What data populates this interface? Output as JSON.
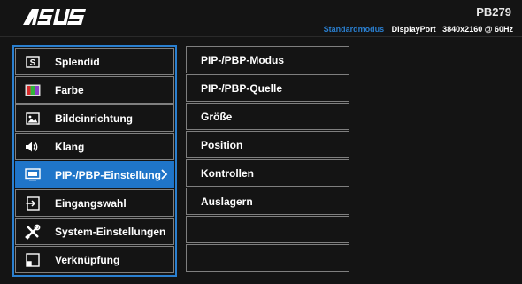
{
  "header": {
    "brand": "ASUS",
    "model": "PB279",
    "mode": "Standardmodus",
    "input": "DisplayPort",
    "resolution": "3840x2160 @ 60Hz"
  },
  "main_menu": {
    "items": [
      {
        "label": "Splendid",
        "icon": "splendid-icon"
      },
      {
        "label": "Farbe",
        "icon": "color-icon"
      },
      {
        "label": "Bildeinrichtung",
        "icon": "image-icon"
      },
      {
        "label": "Klang",
        "icon": "speaker-icon"
      },
      {
        "label": "PIP-/PBP-Einstellung",
        "icon": "pip-icon"
      },
      {
        "label": "Eingangswahl",
        "icon": "input-icon"
      },
      {
        "label": "System-Einstellungen",
        "icon": "tools-icon"
      },
      {
        "label": "Verknüpfung",
        "icon": "shortcut-icon"
      }
    ],
    "selected_index": 4
  },
  "sub_menu": {
    "items": [
      {
        "label": "PIP-/PBP-Modus"
      },
      {
        "label": "PIP-/PBP-Quelle"
      },
      {
        "label": "Größe"
      },
      {
        "label": "Position"
      },
      {
        "label": "Kontrollen"
      },
      {
        "label": "Auslagern"
      },
      {
        "label": ""
      },
      {
        "label": ""
      }
    ]
  },
  "colors": {
    "accent": "#1f75c9",
    "background": "#141414",
    "border": "#7f7f7f"
  }
}
